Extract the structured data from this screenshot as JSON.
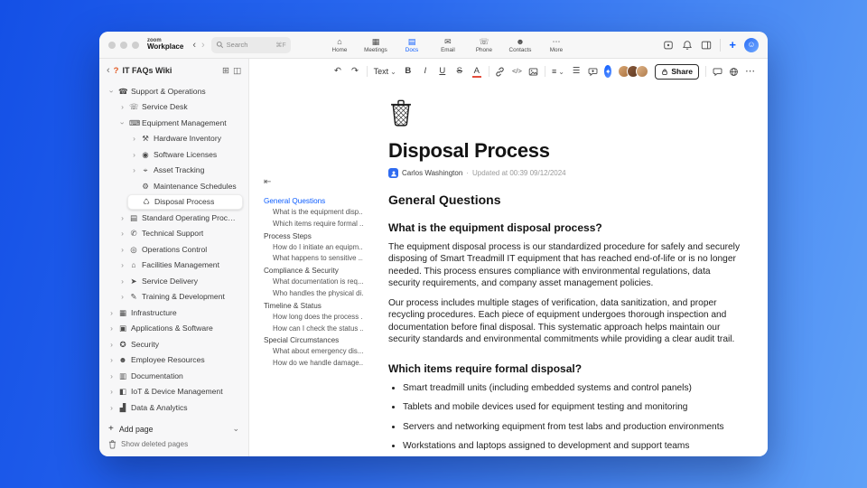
{
  "chrome": {
    "brand_top": "zoom",
    "brand_bottom": "Workplace",
    "search_placeholder": "Search",
    "search_shortcut": "⌘F",
    "nav": [
      {
        "label": "Home",
        "glyph": "⌂"
      },
      {
        "label": "Meetings",
        "glyph": "▦"
      },
      {
        "label": "Docs",
        "glyph": "▤"
      },
      {
        "label": "Email",
        "glyph": "✉"
      },
      {
        "label": "Phone",
        "glyph": "☏"
      },
      {
        "label": "Contacts",
        "glyph": "☻"
      },
      {
        "label": "More",
        "glyph": "⋯"
      }
    ],
    "plus": "+",
    "avatar_face": "☺"
  },
  "icons": {
    "chevron": "›",
    "back": "‹",
    "forward": "›",
    "caret": "⌄",
    "collapse": "⇤",
    "plus": "+",
    "more": "⋯",
    "dot": "·"
  },
  "colors": {
    "accent": "#0b5cff",
    "badge_orange": "#e25822"
  },
  "sidebar": {
    "badge": "?",
    "title": "IT FAQs Wiki",
    "items": [
      {
        "label": "Support & Operations",
        "glyph": "☎"
      },
      {
        "label": "Service Desk",
        "glyph": "☏"
      },
      {
        "label": "Equipment Management",
        "glyph": "⌨"
      },
      {
        "label": "Hardware Inventory",
        "glyph": "⚒"
      },
      {
        "label": "Software Licenses",
        "glyph": "◉"
      },
      {
        "label": "Asset Tracking",
        "glyph": "⌖"
      },
      {
        "label": "Maintenance Schedules",
        "glyph": "⚙"
      },
      {
        "label": "Disposal Process",
        "glyph": "♺"
      },
      {
        "label": "Standard Operating Procedures",
        "glyph": "▤"
      },
      {
        "label": "Technical Support",
        "glyph": "✆"
      },
      {
        "label": "Operations Control",
        "glyph": "◎"
      },
      {
        "label": "Facilities Management",
        "glyph": "⌂"
      },
      {
        "label": "Service Delivery",
        "glyph": "➤"
      },
      {
        "label": "Training & Development",
        "glyph": "✎"
      },
      {
        "label": "Infrastructure",
        "glyph": "▦"
      },
      {
        "label": "Applications & Software",
        "glyph": "▣"
      },
      {
        "label": "Security",
        "glyph": "✪"
      },
      {
        "label": "Employee Resources",
        "glyph": "☻"
      },
      {
        "label": "Documentation",
        "glyph": "▥"
      },
      {
        "label": "IoT & Device Management",
        "glyph": "◧"
      },
      {
        "label": "Data & Analytics",
        "glyph": "▟"
      }
    ],
    "add_page": "Add page",
    "show_deleted": "Show deleted pages"
  },
  "toolbar": {
    "undo": "↶",
    "redo": "↷",
    "text_style": "Text",
    "bold": "B",
    "italic": "I",
    "underline": "U",
    "strike": "S",
    "color": "A",
    "code": "</>",
    "align": "≡",
    "list": "☰",
    "ai": "✦",
    "share": "Share",
    "more": "⋯"
  },
  "toc": {
    "sections": [
      {
        "title": "General Questions",
        "items": [
          "What is the equipment disp...",
          "Which items require formal ..."
        ]
      },
      {
        "title": "Process Steps",
        "items": [
          "How do I initiate an equipm...",
          "What happens to sensitive ..."
        ]
      },
      {
        "title": "Compliance & Security",
        "items": [
          "What documentation is req...",
          "Who handles the physical di..."
        ]
      },
      {
        "title": "Timeline & Status",
        "items": [
          "How long does the process ...",
          "How can I check the status ..."
        ]
      },
      {
        "title": "Special Circumstances",
        "items": [
          "What about emergency dis...",
          "How do we handle damage..."
        ]
      }
    ]
  },
  "doc": {
    "title": "Disposal Process",
    "author": "Carlos Washington",
    "updated": "Updated at 00:39 09/12/2024",
    "h2": "General Questions",
    "q1": "What is the equipment disposal process?",
    "p1": "The equipment disposal process is our standardized procedure for safely and securely disposing of Smart Treadmill IT equipment that has reached end-of-life or is no longer needed. This process ensures compliance with environmental regulations, data security requirements, and company asset management policies.",
    "p2": "Our process includes multiple stages of verification, data sanitization, and proper recycling procedures. Each piece of equipment undergoes thorough inspection and documentation before final disposal. This systematic approach helps maintain our security standards and environmental commitments while providing a clear audit trail.",
    "q2": "Which items require formal disposal?",
    "bullets": [
      "Smart treadmill units (including embedded systems and control panels)",
      "Tablets and mobile devices used for equipment testing and monitoring",
      "Servers and networking equipment from test labs and production environments",
      "Workstations and laptops assigned to development and support teams"
    ]
  }
}
